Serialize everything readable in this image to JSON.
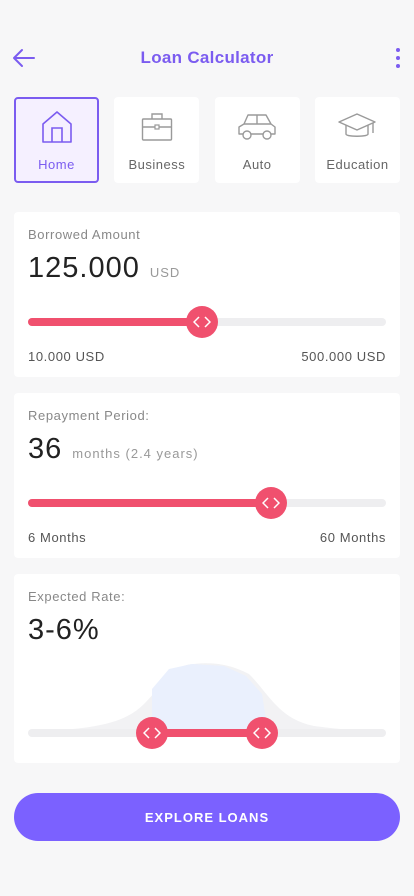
{
  "header": {
    "title": "Loan Calculator",
    "back_icon": "arrow-left-icon",
    "more_icon": "more-vertical-icon",
    "accent_color": "#7b5cf0"
  },
  "categories": [
    {
      "label": "Home",
      "icon": "home-icon",
      "selected": true
    },
    {
      "label": "Business",
      "icon": "briefcase-icon",
      "selected": false
    },
    {
      "label": "Auto",
      "icon": "car-icon",
      "selected": false
    },
    {
      "label": "Education",
      "icon": "graduation-cap-icon",
      "selected": false
    }
  ],
  "borrowed": {
    "label": "Borrowed Amount",
    "value": "125.000",
    "unit": "USD",
    "min_label": "10.000 USD",
    "max_label": "500.000 USD",
    "slider_fraction": 0.486
  },
  "repayment": {
    "label": "Repayment Period:",
    "value": "36",
    "unit": "months (2.4 years)",
    "min_label": "6 Months",
    "max_label": "60 Months",
    "slider_fraction": 0.678
  },
  "rate": {
    "label": "Expected Rate:",
    "value": "3-6%",
    "range_low_fraction": 0.346,
    "range_high_fraction": 0.653
  },
  "cta": {
    "label": "EXPLORE LOANS",
    "color": "#7b61ff"
  },
  "slider_color": "#f0506e"
}
